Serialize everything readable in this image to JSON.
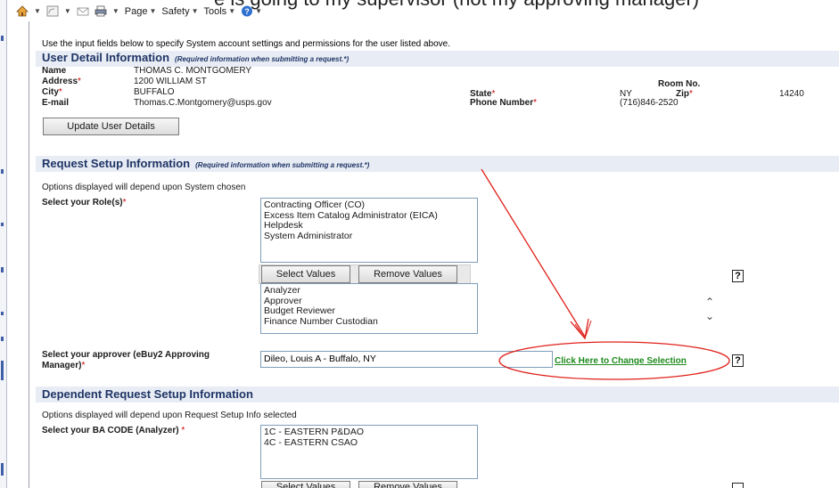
{
  "toolbar": {
    "cut_text": "e is going to my supervisor (not my approving manager)",
    "page_label": "Page",
    "safety_label": "Safety",
    "tools_label": "Tools",
    "icons": [
      "home-icon",
      "feeds-icon",
      "mail-icon",
      "print-icon",
      "help-icon"
    ]
  },
  "intro_text": "Use the input fields below to specify System account settings and permissions for the user listed above.",
  "user_detail": {
    "title": "User Detail Information",
    "note": "(Required information when submitting a request.*)",
    "name_label": "Name",
    "name_value": "THOMAS C. MONTGOMERY",
    "address_label": "Address",
    "address_value": "1200 WILLIAM ST",
    "room_label": "Room No.",
    "city_label": "City",
    "city_value": "BUFFALO",
    "state_label": "State",
    "state_value": "NY",
    "zip_label": "Zip",
    "zip_value": "14240",
    "email_label": "E-mail",
    "email_value": "Thomas.C.Montgomery@usps.gov",
    "phone_label": "Phone Number",
    "phone_value": "(716)846-2520",
    "update_button": "Update User Details",
    "required_marker": "*"
  },
  "request_setup": {
    "title": "Request Setup Information",
    "note": "(Required information when submitting a request.*)",
    "options_text": "Options displayed will depend upon System chosen",
    "role_label": "Select your Role(s)",
    "available_roles": [
      "Contracting Officer (CO)",
      "Excess Item Catalog Administrator (EICA)",
      "Helpdesk",
      "System Administrator"
    ],
    "select_button": "Select Values",
    "remove_button": "Remove Values",
    "selected_roles": [
      "Analyzer",
      "Approver",
      "Budget Reviewer",
      "Finance Number Custodian"
    ],
    "approver_label_line1": "Select your approver (eBuy2 Approving",
    "approver_label_line2": "Manager)",
    "approver_value": "Dileo, Louis A - Buffalo, NY",
    "change_link": "Click Here to Change Selection",
    "help_glyph": "?"
  },
  "dependent_setup": {
    "title": "Dependent Request Setup Information",
    "options_text": "Options displayed will depend upon Request Setup Info selected",
    "ba_label": "Select your BA CODE (Analyzer)",
    "ba_codes": [
      "1C - EASTERN P&DAO",
      "4C - EASTERN CSAO"
    ],
    "select_button": "Select Values",
    "remove_button": "Remove Values"
  },
  "colors": {
    "section_header_bg": "#e8ecf4",
    "section_title": "#1f3566",
    "required": "#cc0000",
    "link": "#1e8a1e",
    "annotation": "#e0201a"
  }
}
